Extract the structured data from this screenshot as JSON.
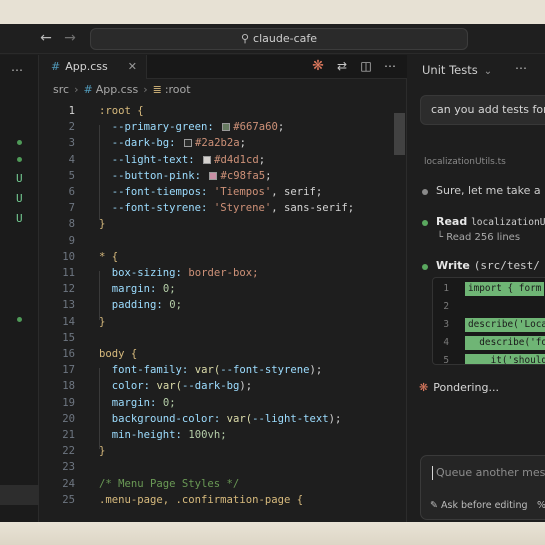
{
  "titlebar": {
    "search_text": "claude-cafe",
    "back_icon": "arrow-left-icon",
    "forward_icon": "arrow-right-icon"
  },
  "leftcol": {
    "git_marks": [
      "U",
      "U",
      "U"
    ]
  },
  "editor": {
    "tab_label": "App.css",
    "breadcrumb": {
      "folder": "src",
      "file": "App.css",
      "symbol": ":root"
    },
    "lines": [
      {
        "n": "1"
      },
      {
        "n": "2"
      },
      {
        "n": "3"
      },
      {
        "n": "4"
      },
      {
        "n": "5"
      },
      {
        "n": "6"
      },
      {
        "n": "7"
      },
      {
        "n": "8"
      },
      {
        "n": "9"
      },
      {
        "n": "10"
      },
      {
        "n": "11"
      },
      {
        "n": "12"
      },
      {
        "n": "13"
      },
      {
        "n": "14"
      },
      {
        "n": "15"
      },
      {
        "n": "16"
      },
      {
        "n": "17"
      },
      {
        "n": "18"
      },
      {
        "n": "19"
      },
      {
        "n": "20"
      },
      {
        "n": "21"
      },
      {
        "n": "22"
      },
      {
        "n": "23"
      },
      {
        "n": "24"
      },
      {
        "n": "25"
      }
    ],
    "code": {
      "l1": ":root {",
      "l2_prop": "--primary-green:",
      "l2_val": "#667a60",
      "l3_prop": "--dark-bg:",
      "l3_val": "#2a2b2a",
      "l4_prop": "--light-text:",
      "l4_val": "#d4d1cd",
      "l5_prop": "--button-pink:",
      "l5_val": "#c98fa5",
      "l6_prop": "--font-tiempos:",
      "l6_val": "'Tiempos'",
      "l6_rest": ", serif;",
      "l7_prop": "--font-styrene:",
      "l7_val": "'Styrene'",
      "l7_rest": ", sans-serif;",
      "l8": "}",
      "l10": "* {",
      "l11_prop": "box-sizing:",
      "l11_val": "border-box;",
      "l12_prop": "margin:",
      "l12_val": "0;",
      "l13_prop": "padding:",
      "l13_val": "0;",
      "l14": "}",
      "l16": "body {",
      "l17_prop": "font-family:",
      "l17_fn": "var(",
      "l17_var": "--font-styrene",
      "l17_end": ");",
      "l18_prop": "color:",
      "l18_fn": "var(",
      "l18_var": "--dark-bg",
      "l18_end": ");",
      "l19_prop": "margin:",
      "l19_val": "0;",
      "l20_prop": "background-color:",
      "l20_fn": "var(",
      "l20_var": "--light-text",
      "l20_end": ");",
      "l21_prop": "min-height:",
      "l21_val": "100vh;",
      "l22": "}",
      "l24": "/* Menu Page Styles */",
      "l25": ".menu-page, .confirmation-page {"
    },
    "swatches": {
      "green": "#667a60",
      "dark": "#2a2b2a",
      "light": "#d4d1cd",
      "pink": "#c98fa5"
    }
  },
  "chat": {
    "title": "Unit Tests",
    "user_message": "can you add tests for",
    "attachment": "localizationUtils.ts",
    "reply": "Sure, let me take a lo",
    "read_tool": "Read",
    "read_arg": "localizationU",
    "read_result": "└ Read 256 lines",
    "write_tool": "Write",
    "write_arg": "(src/test/",
    "diff_lines": [
      {
        "n": "1",
        "code": "import { form"
      },
      {
        "n": "2",
        "code": ""
      },
      {
        "n": "3",
        "code": "describe('Loca"
      },
      {
        "n": "4",
        "code": "  describe('fo"
      },
      {
        "n": "5",
        "code": "    it('should"
      }
    ],
    "thinking": "Pondering...",
    "composer_placeholder": "Queue another mes",
    "composer_option": "Ask before editing",
    "composer_option2": "%"
  }
}
